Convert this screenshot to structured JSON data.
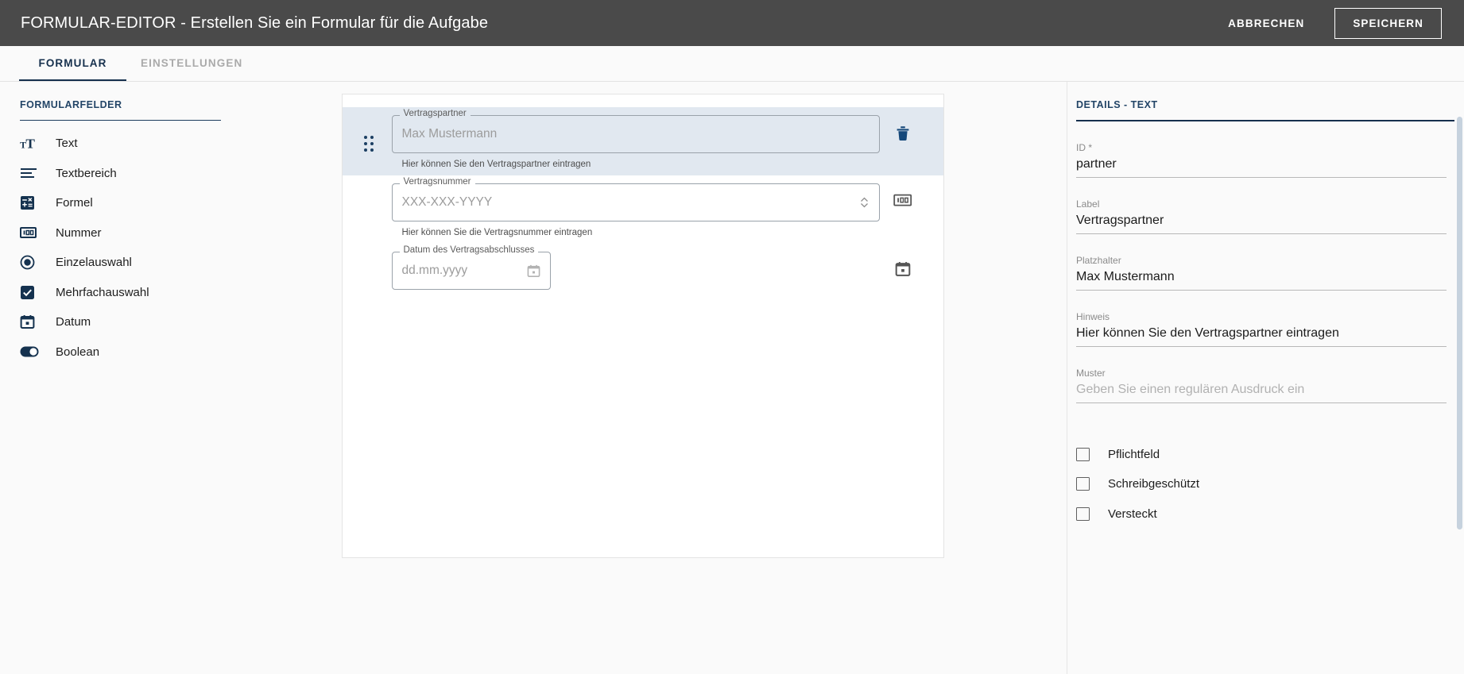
{
  "topbar": {
    "title": "FORMULAR-EDITOR - Erstellen Sie ein Formular für die Aufgabe",
    "cancel_label": "ABBRECHEN",
    "save_label": "SPEICHERN",
    "background": "#4a4a4a"
  },
  "tabs": [
    {
      "label": "FORMULAR",
      "active": true
    },
    {
      "label": "EINSTELLUNGEN",
      "active": false
    }
  ],
  "sidebar": {
    "title": "FORMULARFELDER",
    "accent": "#16304d",
    "items": [
      {
        "label": "Text",
        "icon": "text-format-icon"
      },
      {
        "label": "Textbereich",
        "icon": "text-lines-icon"
      },
      {
        "label": "Formel",
        "icon": "calculator-icon"
      },
      {
        "label": "Nummer",
        "icon": "number-100-icon"
      },
      {
        "label": "Einzelauswahl",
        "icon": "radio-button-icon"
      },
      {
        "label": "Mehrfachauswahl",
        "icon": "checkbox-checked-icon"
      },
      {
        "label": "Datum",
        "icon": "calendar-icon"
      },
      {
        "label": "Boolean",
        "icon": "toggle-switch-icon"
      }
    ]
  },
  "canvas": {
    "fields": [
      {
        "label": "Vertragspartner",
        "placeholder": "Max Mustermann",
        "hint": "Hier können Sie den Vertragspartner eintragen",
        "selected": true,
        "trailing_icon": "trash-icon",
        "kind": "text"
      },
      {
        "label": "Vertragsnummer",
        "placeholder": "XXX-XXX-YYYY",
        "hint": "Hier können Sie die Vertragsnummer eintragen",
        "selected": false,
        "trailing_icon": "number-100-icon",
        "kind": "number"
      },
      {
        "label": "Datum des Vertragsabschlusses",
        "placeholder": "dd.mm.yyyy",
        "hint": "",
        "selected": false,
        "trailing_icon": "calendar-icon",
        "kind": "date"
      }
    ]
  },
  "details": {
    "title": "DETAILS - TEXT",
    "accent": "#16304d",
    "fields": [
      {
        "label": "ID *",
        "value": "partner",
        "is_placeholder": false
      },
      {
        "label": "Label",
        "value": "Vertragspartner",
        "is_placeholder": false
      },
      {
        "label": "Platzhalter",
        "value": "Max Mustermann",
        "is_placeholder": false
      },
      {
        "label": "Hinweis",
        "value": "Hier können Sie den Vertragspartner eintragen",
        "is_placeholder": false
      },
      {
        "label": "Muster",
        "value": "Geben Sie einen regulären Ausdruck ein",
        "is_placeholder": true
      }
    ],
    "checkboxes": [
      {
        "label": "Pflichtfeld",
        "checked": false
      },
      {
        "label": "Schreibgeschützt",
        "checked": false
      },
      {
        "label": "Versteckt",
        "checked": false
      }
    ]
  }
}
